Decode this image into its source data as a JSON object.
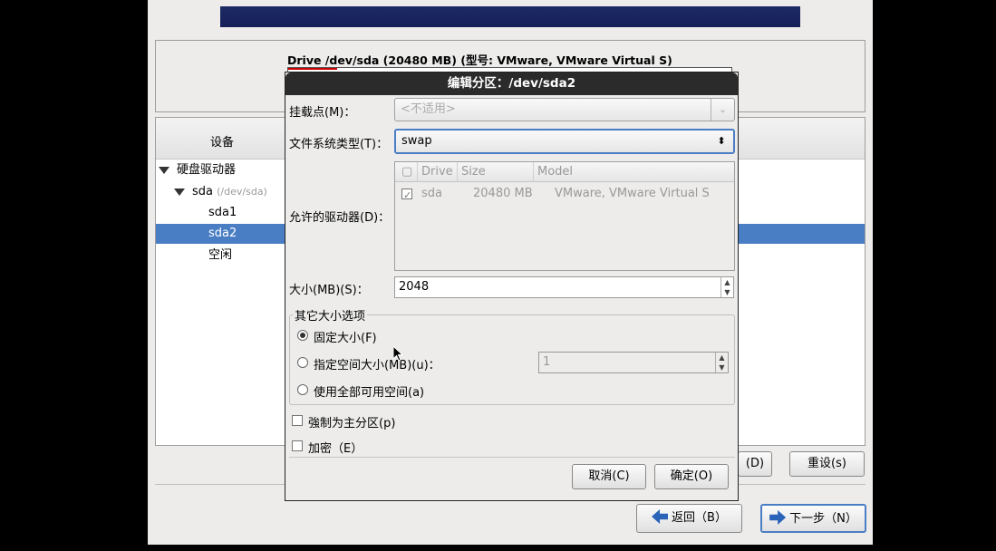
{
  "drive": {
    "title": "Drive /dev/sda (20480 MB) (型号: VMware, VMware Virtual S)"
  },
  "tree": {
    "column_device": "设备",
    "rows": [
      {
        "label": "硬盘驱动器",
        "path": ""
      },
      {
        "label": "sda",
        "path": "(/dev/sda)"
      },
      {
        "label": "sda1",
        "path": ""
      },
      {
        "label": "sda2",
        "path": ""
      },
      {
        "label": "空闲",
        "path": ""
      }
    ],
    "selected_row": "sda2"
  },
  "main_buttons": {
    "delete_partial": "(D)",
    "reset": "重设(s)",
    "back": "返回（B）",
    "next": "下一步（N）"
  },
  "dialog": {
    "title": "编辑分区：/dev/sda2",
    "mount_label": "挂载点(M)：",
    "mount_value": "<不适用>",
    "fs_label": "文件系统类型(T)：",
    "fs_value": "swap",
    "drives_label": "允许的驱动器(D)：",
    "drives_columns": {
      "drive": "Drive",
      "size": "Size",
      "model": "Model"
    },
    "drives_row": {
      "drive": "sda",
      "size": "20480 MB",
      "model": "VMware, VMware Virtual S",
      "checked": true
    },
    "size_label": "大小(MB)(S)：",
    "size_value": "2048",
    "other_size_legend": "其它大小选项",
    "opt_fixed": "固定大小(F)",
    "opt_up_to": "指定空间大小(MB)(u)：",
    "up_to_value": "1",
    "opt_fill": "使用全部可用空间(a)",
    "force_primary": "強制为主分区(p)",
    "encrypt": "加密（E）",
    "cancel": "取消(C)",
    "ok": "确定(O)"
  },
  "colors": {
    "title_bar": "#2b2b2b",
    "selection": "#4a7ec4",
    "banner": "#1e2a64"
  }
}
